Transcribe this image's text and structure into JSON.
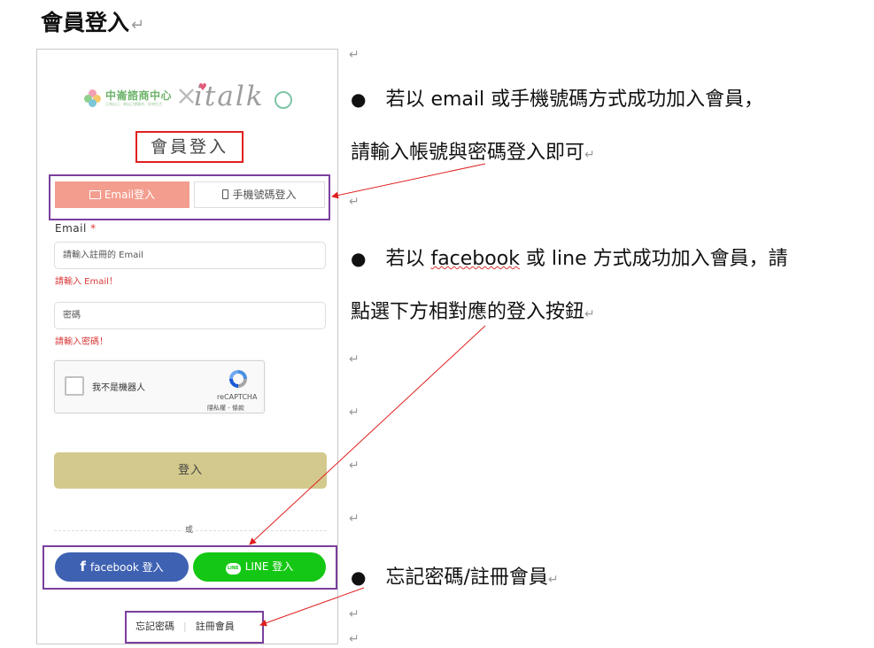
{
  "heading": "會員登入",
  "return_mark": "↵",
  "logo": {
    "brand_cn": "中崙諮商中心",
    "brand_sub": "正視自己．做自己想要的．珍視生活",
    "x": "×",
    "italk": "italk"
  },
  "login_title": "會員登入",
  "tabs": {
    "email": "Email登入",
    "phone": "手機號碼登入"
  },
  "form": {
    "email_label": "Email",
    "required_mark": "*",
    "email_placeholder": "請輸入註冊的 Email",
    "email_error": "請輸入 Email！",
    "password_placeholder": "密碼",
    "password_error": "請輸入密碼！"
  },
  "recaptcha": {
    "label": "我不是機器人",
    "brand": "reCAPTCHA",
    "terms": "隱私權 - 條款"
  },
  "login_button": "登入",
  "or_text": "或",
  "social": {
    "facebook": "facebook 登入",
    "line": "LINE 登入",
    "line_icon_text": "LINE"
  },
  "links": {
    "forgot": "忘記密碼",
    "register": "註冊會員"
  },
  "notes": {
    "note1_line1_a": "若以 email 或手機號碼方式成功加入會員，",
    "note1_line2": "請輸入帳號與密碼登入即可",
    "note2_line1_a": "若以 ",
    "note2_line1_b": "facebook",
    "note2_line1_c": " 或 line 方式成功加入會員，請",
    "note2_line2": "點選下方相對應的登入按鈕",
    "note3": "忘記密碼/註冊會員"
  },
  "colors": {
    "email_tab": "#f39d8f",
    "login_button": "#d3c98c",
    "facebook": "#3e61b2",
    "line": "#14c714",
    "highlight_red": "#e02020",
    "highlight_purple": "#7a3f9d"
  }
}
